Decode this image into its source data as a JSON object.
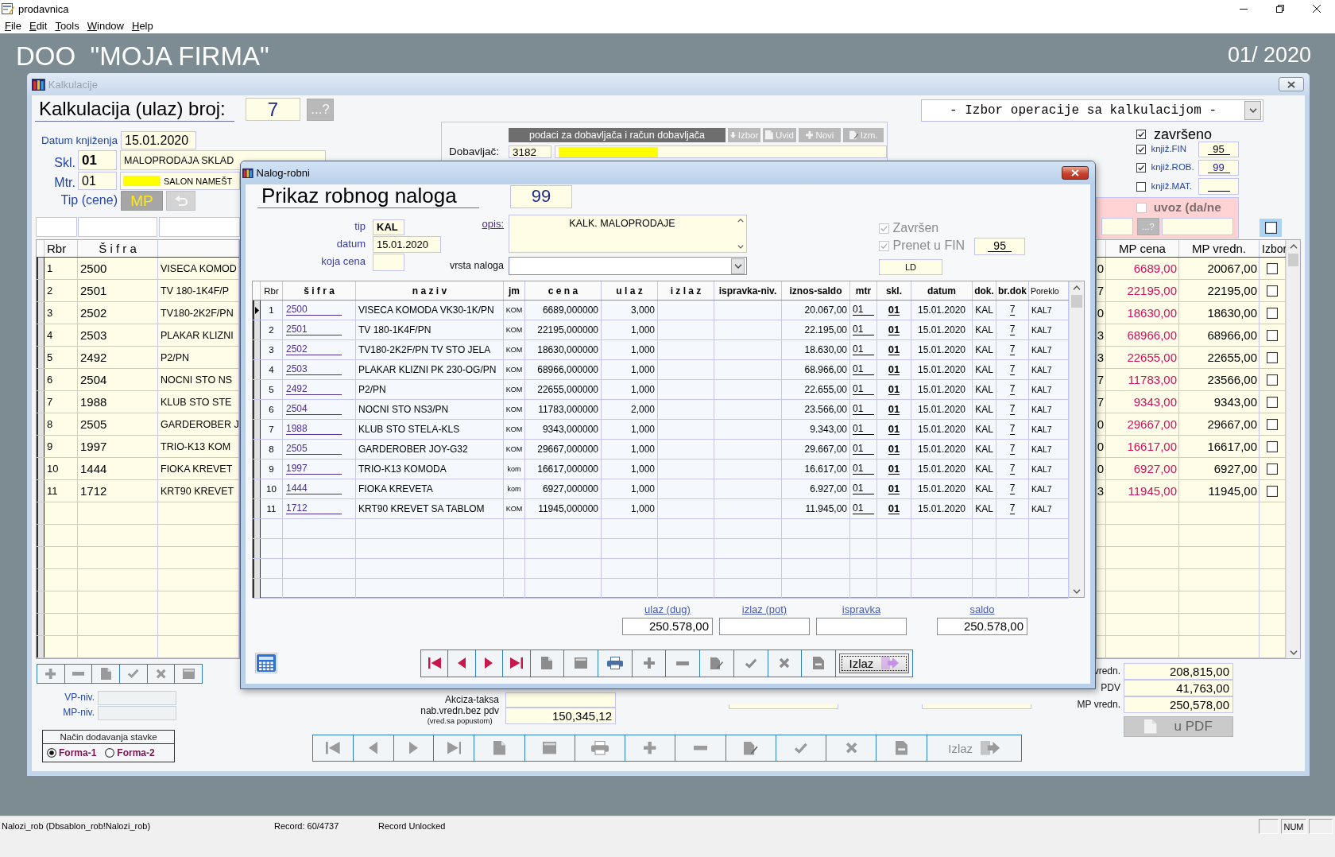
{
  "window": {
    "title": "prodavnica"
  },
  "menu": [
    {
      "label": "File"
    },
    {
      "label": "Edit"
    },
    {
      "label": "Tools"
    },
    {
      "label": "Window"
    },
    {
      "label": "Help"
    }
  ],
  "header": {
    "company": "DOO  \"MOJA FIRMA\"",
    "period": "01/ 2020"
  },
  "calc": {
    "title": "Kalkulacije",
    "heading": "Kalkulacija (ulaz) broj:",
    "number": "7",
    "lookup": "...?",
    "operation_select": "- Izbor operacije sa kalkulacijom -",
    "posting_date": {
      "label": "Datum knjiženja",
      "value": "15.01.2020"
    },
    "warehouse": {
      "label": "Skl.",
      "code": "01",
      "name": "MALOPRODAJA SKLAD"
    },
    "cost_center": {
      "label": "Mtr.",
      "code": "01",
      "name": "SALON NAMEŠT"
    },
    "price_type": {
      "label": "Tip (cene)",
      "value": "MP"
    },
    "supplier": {
      "title": "podaci za dobavljača i račun dobavljača",
      "buttons": [
        {
          "kind": "down",
          "label": "Izbor"
        },
        {
          "kind": "page",
          "label": "Uvid"
        },
        {
          "kind": "plus",
          "label": "Novi"
        },
        {
          "kind": "edit",
          "label": "Izm."
        }
      ],
      "label": "Dobavljač:",
      "code": "3182"
    },
    "flags": [
      {
        "kind": "main",
        "label": "završeno",
        "checked": true
      },
      {
        "kind": "posting",
        "label": "knjiž.FIN",
        "checked": true,
        "value": "95"
      },
      {
        "kind": "link",
        "label": "knjiž.ROB.",
        "checked": true,
        "value": "99"
      },
      {
        "kind": "posting",
        "label": "knjiž.MAT.",
        "checked": false
      }
    ],
    "import": {
      "label": "uvoz (da/ne",
      "checked": false,
      "disabled": true,
      "lookup": "...?"
    },
    "select_all": {
      "checked": false
    },
    "table": {
      "columns": {
        "rbr": "Rbr",
        "sifra": "Š i f r a",
        "mp_cena": "MP cena",
        "mp_vredn": "MP vredn.",
        "izbor": "Izbor"
      },
      "rows": [
        {
          "rbr": "1",
          "sifra": "2500",
          "column_3": "VISECA KOMOD",
          "column_4": "0",
          "mp_cena": "6689,00",
          "mp_vredn": "20067,00",
          "checked": false
        },
        {
          "rbr": "2",
          "sifra": "2501",
          "column_3": "TV 180-1K4F/P",
          "column_4": "7",
          "mp_cena": "22195,00",
          "mp_vredn": "22195,00",
          "checked": false
        },
        {
          "rbr": "3",
          "sifra": "2502",
          "column_3": "TV180-2K2F/PN",
          "column_4": "0",
          "mp_cena": "18630,00",
          "mp_vredn": "18630,00",
          "checked": false
        },
        {
          "rbr": "4",
          "sifra": "2503",
          "column_3": "PLAKAR KLIZNI",
          "column_4": "3",
          "mp_cena": "68966,00",
          "mp_vredn": "68966,00",
          "checked": false
        },
        {
          "rbr": "5",
          "sifra": "2492",
          "column_3": "P2/PN",
          "column_4": "3",
          "mp_cena": "22655,00",
          "mp_vredn": "22655,00",
          "checked": false
        },
        {
          "rbr": "6",
          "sifra": "2504",
          "column_3": "NOCNI STO NS",
          "column_4": "7",
          "mp_cena": "11783,00",
          "mp_vredn": "23566,00",
          "checked": false
        },
        {
          "rbr": "7",
          "sifra": "1988",
          "column_3": "KLUB STO STE",
          "column_4": "7",
          "mp_cena": "9343,00",
          "mp_vredn": "9343,00",
          "checked": false
        },
        {
          "rbr": "8",
          "sifra": "2505",
          "column_3": "GARDEROBER J",
          "column_4": "0",
          "mp_cena": "29667,00",
          "mp_vredn": "29667,00",
          "checked": false
        },
        {
          "rbr": "9",
          "sifra": "1997",
          "column_3": "TRIO-K13 KOM",
          "column_4": "0",
          "mp_cena": "16617,00",
          "mp_vredn": "16617,00",
          "checked": false
        },
        {
          "rbr": "10",
          "sifra": "1444",
          "column_3": "FIOKA KREVET",
          "column_4": "0",
          "mp_cena": "6927,00",
          "mp_vredn": "6927,00",
          "checked": false
        },
        {
          "rbr": "11",
          "sifra": "1712",
          "column_3": "KRT90 KREVET",
          "column_4": "3",
          "mp_cena": "11945,00",
          "mp_vredn": "11945,00",
          "checked": false
        }
      ]
    },
    "row_toolbar": [
      {
        "kind": "plus"
      },
      {
        "kind": "minus"
      },
      {
        "kind": "page"
      },
      {
        "kind": "check"
      },
      {
        "kind": "delete"
      },
      {
        "kind": "card"
      }
    ],
    "levels": [
      {
        "label": "VP-niv."
      },
      {
        "label": "MP-niv."
      }
    ],
    "add_mode": {
      "title": "Način dodavanja stavke",
      "options": [
        {
          "label": "Forma-1",
          "selected": true
        },
        {
          "label": "Forma-2",
          "selected": false
        }
      ]
    },
    "excise": {
      "label": "Akciza-taksa"
    },
    "net_value": {
      "label": "nab.vredn.bez pdv",
      "note": "(vred.sa popustom)",
      "value": "150,345,12"
    },
    "totals": [
      {
        "label": "vredn.",
        "value": "208,815,00"
      },
      {
        "label": "PDV",
        "value": "41,763,00"
      },
      {
        "label": "MP vredn.",
        "value": "250,578,00"
      }
    ],
    "pdf_button": {
      "label": "u PDF",
      "disabled": true
    },
    "toolbar": {
      "disabled": true,
      "buttons": [
        {
          "kind": "first"
        },
        {
          "kind": "prev"
        },
        {
          "kind": "next"
        },
        {
          "kind": "last"
        },
        {
          "kind": "page"
        },
        {
          "kind": "card"
        },
        {
          "kind": "print"
        },
        {
          "kind": "plus"
        },
        {
          "kind": "minus"
        },
        {
          "kind": "edit"
        },
        {
          "kind": "check"
        },
        {
          "kind": "delete"
        },
        {
          "kind": "page-minus"
        },
        {
          "kind": "exit",
          "label": "Izlaz"
        }
      ]
    }
  },
  "dialog": {
    "title": "Nalog-robni",
    "heading": "Prikaz robnog naloga",
    "number": "99",
    "type": {
      "label": "tip",
      "value": "KAL"
    },
    "date": {
      "label": "datum",
      "value": "15.01.2020"
    },
    "price": {
      "label": "koja cena"
    },
    "description": {
      "label": "opis:",
      "value": "KALK. MALOPRODAJE"
    },
    "order_type": {
      "label": "vrsta naloga"
    },
    "finished": {
      "label": "Završen",
      "checked": true,
      "disabled": true
    },
    "posted": {
      "label": "Prenet u FIN",
      "checked": true,
      "disabled": true,
      "value": "95"
    },
    "code": "LD",
    "table": {
      "columns": [
        "Rbr",
        "š i f r a",
        "n a z i v",
        "jm",
        "c e n a",
        "u l a z",
        "i z l a z",
        "ispravka-niv.",
        "iznos-saldo",
        "mtr",
        "skl.",
        "datum",
        "dok.",
        "br.dok",
        "Poreklo"
      ],
      "rows": [
        {
          "selected": true,
          "rbr": "1",
          "sifra": "2500",
          "naziv": "VISECA KOMODA VK30-1K/PN",
          "jm": "KOM",
          "cena": "6689,000000",
          "ulaz": "3,000",
          "iznos_saldo": "20.067,00",
          "mtr": "01",
          "skl": "01",
          "datum": "15.01.2020",
          "dok": "KAL",
          "br_dok": "7",
          "poreklo": "KAL7"
        },
        {
          "selected": false,
          "rbr": "2",
          "sifra": "2501",
          "naziv": "TV 180-1K4F/PN",
          "jm": "KOM",
          "cena": "22195,000000",
          "ulaz": "1,000",
          "iznos_saldo": "22.195,00",
          "mtr": "01",
          "skl": "01",
          "datum": "15.01.2020",
          "dok": "KAL",
          "br_dok": "7",
          "poreklo": "KAL7"
        },
        {
          "selected": false,
          "rbr": "3",
          "sifra": "2502",
          "naziv": "TV180-2K2F/PN TV STO JELA",
          "jm": "KOM",
          "cena": "18630,000000",
          "ulaz": "1,000",
          "iznos_saldo": "18.630,00",
          "mtr": "01",
          "skl": "01",
          "datum": "15.01.2020",
          "dok": "KAL",
          "br_dok": "7",
          "poreklo": "KAL7"
        },
        {
          "selected": false,
          "rbr": "4",
          "sifra": "2503",
          "naziv": "PLAKAR KLIZNI PK 230-OG/PN",
          "jm": "KOM",
          "cena": "68966,000000",
          "ulaz": "1,000",
          "iznos_saldo": "68.966,00",
          "mtr": "01",
          "skl": "01",
          "datum": "15.01.2020",
          "dok": "KAL",
          "br_dok": "7",
          "poreklo": "KAL7"
        },
        {
          "selected": false,
          "rbr": "5",
          "sifra": "2492",
          "naziv": "P2/PN",
          "jm": "KOM",
          "cena": "22655,000000",
          "ulaz": "1,000",
          "iznos_saldo": "22.655,00",
          "mtr": "01",
          "skl": "01",
          "datum": "15.01.2020",
          "dok": "KAL",
          "br_dok": "7",
          "poreklo": "KAL7"
        },
        {
          "selected": false,
          "rbr": "6",
          "sifra": "2504",
          "naziv": "NOCNI STO NS3/PN",
          "jm": "KOM",
          "cena": "11783,000000",
          "ulaz": "2,000",
          "iznos_saldo": "23.566,00",
          "mtr": "01",
          "skl": "01",
          "datum": "15.01.2020",
          "dok": "KAL",
          "br_dok": "7",
          "poreklo": "KAL7"
        },
        {
          "selected": false,
          "rbr": "7",
          "sifra": "1988",
          "naziv": "KLUB STO STELA-KLS",
          "jm": "KOM",
          "cena": "9343,000000",
          "ulaz": "1,000",
          "iznos_saldo": "9.343,00",
          "mtr": "01",
          "skl": "01",
          "datum": "15.01.2020",
          "dok": "KAL",
          "br_dok": "7",
          "poreklo": "KAL7"
        },
        {
          "selected": false,
          "rbr": "8",
          "sifra": "2505",
          "naziv": "GARDEROBER JOY-G32",
          "jm": "KOM",
          "cena": "29667,000000",
          "ulaz": "1,000",
          "iznos_saldo": "29.667,00",
          "mtr": "01",
          "skl": "01",
          "datum": "15.01.2020",
          "dok": "KAL",
          "br_dok": "7",
          "poreklo": "KAL7"
        },
        {
          "selected": false,
          "rbr": "9",
          "sifra": "1997",
          "naziv": "TRIO-K13 KOMODA",
          "jm": "kom",
          "cena": "16617,000000",
          "ulaz": "1,000",
          "iznos_saldo": "16.617,00",
          "mtr": "01",
          "skl": "01",
          "datum": "15.01.2020",
          "dok": "KAL",
          "br_dok": "7",
          "poreklo": "KAL7"
        },
        {
          "selected": false,
          "rbr": "10",
          "sifra": "1444",
          "naziv": "FIOKA KREVETA",
          "jm": "kom",
          "cena": "6927,000000",
          "ulaz": "1,000",
          "iznos_saldo": "6.927,00",
          "mtr": "01",
          "skl": "01",
          "datum": "15.01.2020",
          "dok": "KAL",
          "br_dok": "7",
          "poreklo": "KAL7"
        },
        {
          "selected": false,
          "rbr": "11",
          "sifra": "1712",
          "naziv": "KRT90 KREVET SA TABLOM",
          "jm": "KOM",
          "cena": "11945,000000",
          "ulaz": "1,000",
          "iznos_saldo": "11.945,00",
          "mtr": "01",
          "skl": "01",
          "datum": "15.01.2020",
          "dok": "KAL",
          "br_dok": "7",
          "poreklo": "KAL7"
        }
      ]
    },
    "totals": [
      {
        "label": "ulaz (dug)",
        "value": "250.578,00"
      },
      {
        "label": "izlaz (pot)"
      },
      {
        "label": "ispravka"
      },
      {
        "label": "saldo",
        "value": "250.578,00"
      }
    ],
    "toolbar": {
      "disabled": false,
      "buttons": [
        {
          "kind": "first",
          "focused": false
        },
        {
          "kind": "prev",
          "focused": false
        },
        {
          "kind": "next",
          "focused": false
        },
        {
          "kind": "last",
          "focused": false
        },
        {
          "kind": "page",
          "focused": false
        },
        {
          "kind": "card",
          "focused": false
        },
        {
          "kind": "print",
          "focused": false
        },
        {
          "kind": "plus",
          "focused": false
        },
        {
          "kind": "minus",
          "focused": false
        },
        {
          "kind": "edit",
          "focused": false
        },
        {
          "kind": "check",
          "focused": false
        },
        {
          "kind": "delete",
          "focused": false
        },
        {
          "kind": "page-minus",
          "focused": false
        },
        {
          "kind": "exit",
          "label": "Izlaz",
          "focused": true
        }
      ]
    }
  },
  "status_bar": {
    "source": "Nalozi_rob (Dbsablon_rob!Nalozi_rob)",
    "record": "Record: 60/4737",
    "lock": "Record Unlocked",
    "indicator": "NUM"
  }
}
